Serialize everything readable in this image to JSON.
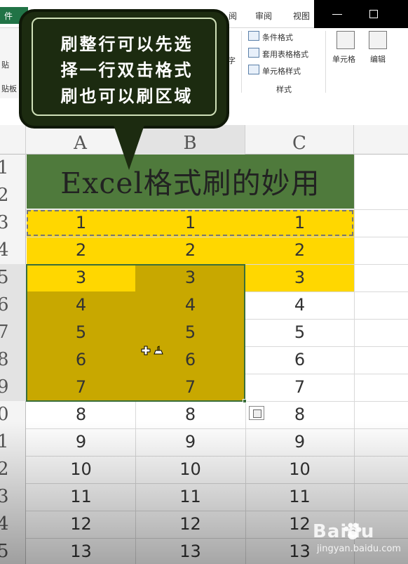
{
  "ribbon": {
    "file_tab": "件",
    "tabs": [
      "阅",
      "审阅",
      "视图"
    ],
    "left_labels": [
      "贴",
      "贴板"
    ],
    "left_partial": "字",
    "style_items": [
      "条件格式",
      "套用表格格式",
      "单元格样式"
    ],
    "styles_group": "样式",
    "cells_button": "单元格",
    "edit_button": "编辑"
  },
  "callout": {
    "lines": [
      "刷整行可以先选",
      "择一行双击格式",
      "刷也可以刷区域"
    ]
  },
  "sheet": {
    "columns": [
      "A",
      "B",
      "C"
    ],
    "row_numbers": [
      "1",
      "2",
      "3",
      "4",
      "5",
      "6",
      "7",
      "8",
      "9",
      "0",
      "1",
      "2",
      "3",
      "4",
      "5"
    ],
    "title": "Excel格式刷的妙用",
    "rows": [
      [
        "1",
        "1",
        "1"
      ],
      [
        "2",
        "2",
        "2"
      ],
      [
        "3",
        "3",
        "3"
      ],
      [
        "4",
        "4",
        "4"
      ],
      [
        "5",
        "5",
        "5"
      ],
      [
        "6",
        "6",
        "6"
      ],
      [
        "7",
        "7",
        "7"
      ],
      [
        "8",
        "8",
        "8"
      ],
      [
        "9",
        "9",
        "9"
      ],
      [
        "10",
        "10",
        "10"
      ],
      [
        "11",
        "11",
        "11"
      ],
      [
        "12",
        "12",
        "12"
      ],
      [
        "13",
        "13",
        "13"
      ]
    ]
  },
  "colors": {
    "title_band": "#4f7a3c",
    "yellow": "#ffd700",
    "selection_fill": "#c8a800",
    "callout_bg": "#1c2b10"
  },
  "watermark": {
    "main": "Baidu",
    "sub": "jingyan.baidu.com"
  }
}
